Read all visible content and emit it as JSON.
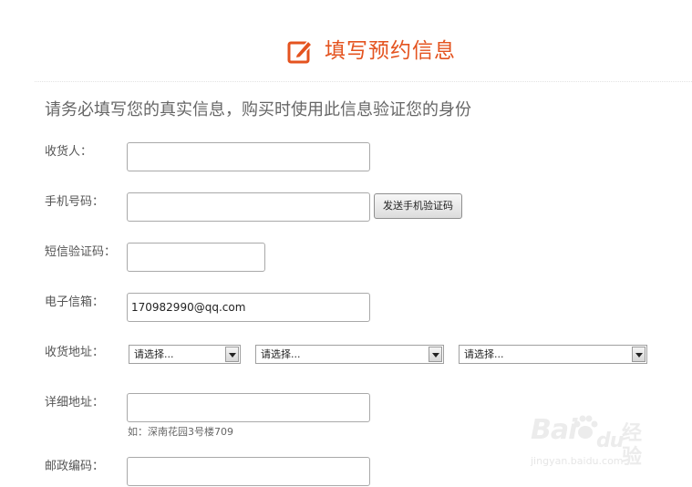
{
  "header": {
    "title": "填写预约信息",
    "icon": "edit-icon",
    "accent_color": "#e4531f"
  },
  "subtitle": "请务必填写您的真实信息，购买时使用此信息验证您的身份",
  "form": {
    "receiver": {
      "label": "收货人：",
      "value": ""
    },
    "phone": {
      "label": "手机号码：",
      "value": "",
      "send_code_button": "发送手机验证码"
    },
    "sms_code": {
      "label": "短信验证码：",
      "value": ""
    },
    "email": {
      "label": "电子信箱：",
      "value": "170982990@qq.com"
    },
    "address": {
      "label": "收货地址：",
      "province": "请选择...",
      "city": "请选择...",
      "district": "请选择..."
    },
    "detail_address": {
      "label": "详细地址：",
      "value": "",
      "hint": "如：深南花园3号楼709"
    },
    "postcode": {
      "label": "邮政编码：",
      "value": ""
    }
  },
  "watermark": {
    "brand_left": "Bai",
    "brand_right": "du",
    "brand_cn": "经验",
    "url": "jingyan.baidu.com"
  }
}
